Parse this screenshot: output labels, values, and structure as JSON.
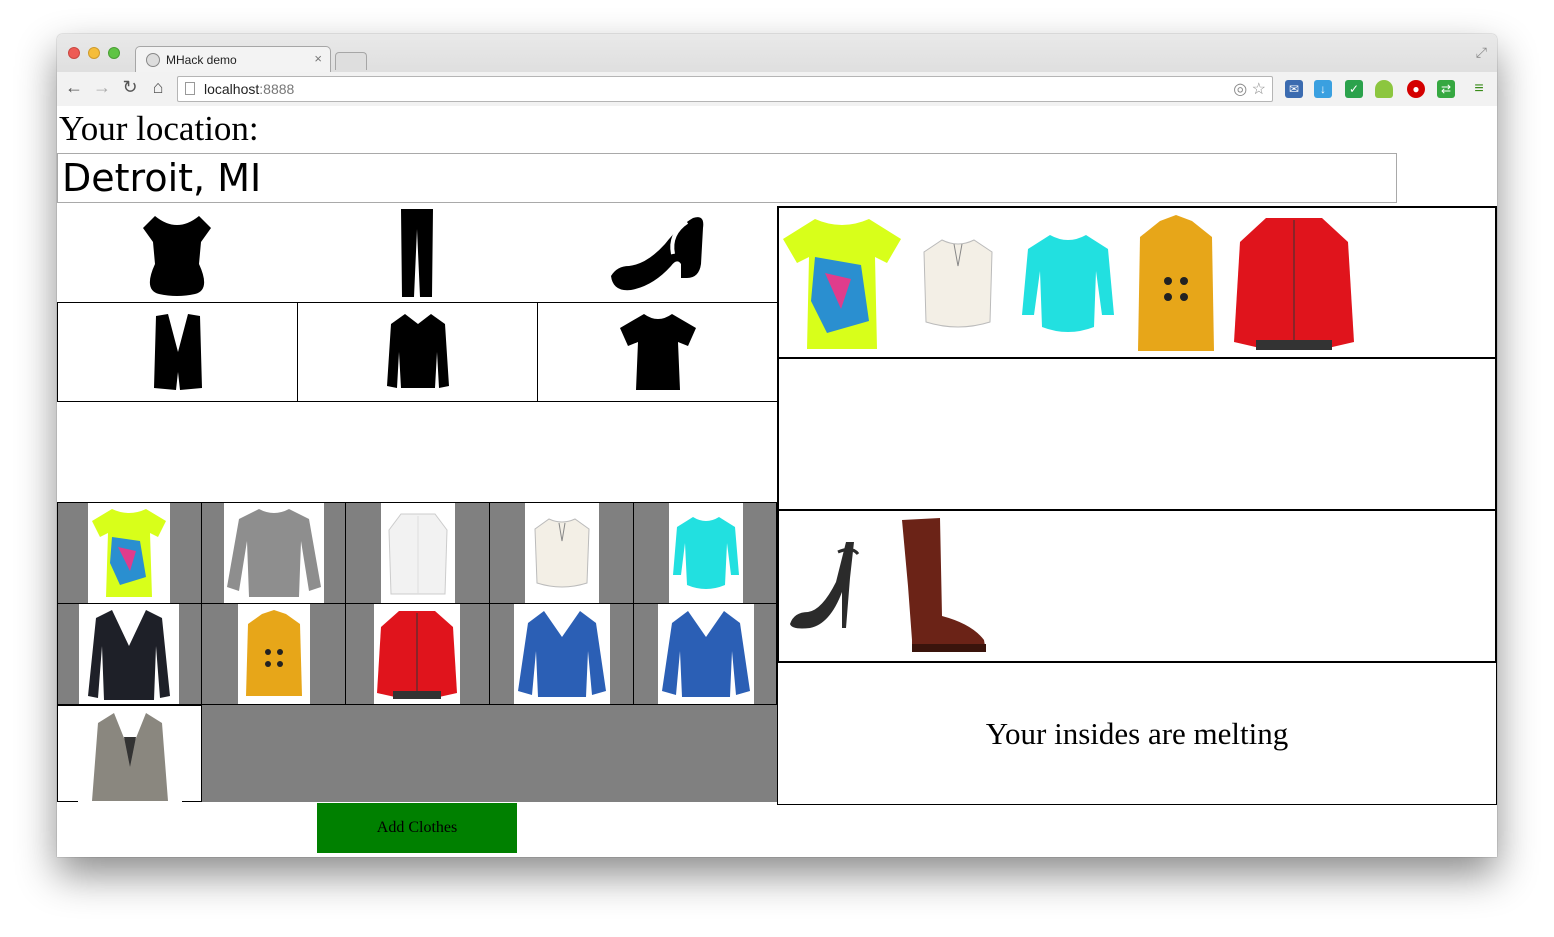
{
  "browser": {
    "tab_title": "MHack demo",
    "tab_close": "×",
    "url_host": "localhost",
    "url_port": ":8888",
    "nav": {
      "back": "←",
      "forward": "→",
      "reload": "↻",
      "home": "⌂"
    },
    "icons": [
      "target-icon",
      "star-icon",
      "mail-icon",
      "download-icon",
      "chrome-ext-icon",
      "android-icon",
      "stop-icon",
      "sync-icon",
      "menu-icon"
    ]
  },
  "location": {
    "label": "Your location:",
    "value": "Detroit, MI"
  },
  "categories": {
    "row1": [
      "top-icon",
      "pants-icon",
      "sandal-icon"
    ],
    "row2": [
      "vest-icon",
      "jacket-icon",
      "tshirt-icon"
    ]
  },
  "wardrobe": {
    "row1": [
      "neon-graphic-tee",
      "gray-sweater",
      "white-cardigan",
      "cream-blouse",
      "cyan-blouse"
    ],
    "row2": [
      "black-blazer",
      "mustard-coat",
      "red-bomber",
      "blue-leather-jacket",
      "blue-leather-jacket"
    ],
    "row3": [
      "gray-blazer"
    ]
  },
  "outfit": {
    "tops": [
      "neon-graphic-tee",
      "cream-blouse",
      "cyan-blouse",
      "mustard-coat",
      "red-bomber"
    ],
    "shoes": [
      "strappy-heel",
      "brown-boot"
    ]
  },
  "message": "Your insides are melting",
  "add_button": "Add Clothes",
  "colors": {
    "add_button": "#008000",
    "grid_gray": "#808080"
  }
}
